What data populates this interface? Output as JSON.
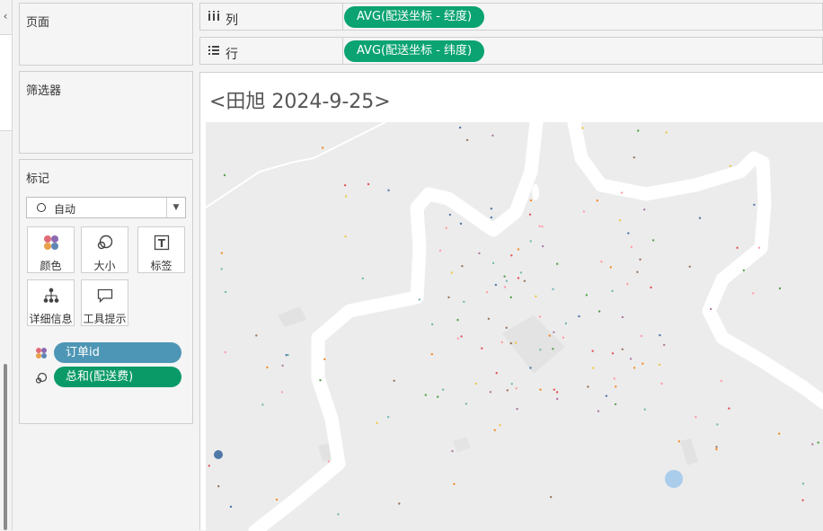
{
  "left_panel": {
    "collapse_icon": "chevron-left-icon"
  },
  "pages_card": {
    "title": "页面"
  },
  "filters_card": {
    "title": "筛选器"
  },
  "columns_shelf": {
    "label": "列",
    "icon": "columns-icon",
    "pill": "AVG(配送坐标 - 经度)"
  },
  "rows_shelf": {
    "label": "行",
    "icon": "rows-icon",
    "pill": "AVG(配送坐标 - 纬度)"
  },
  "marks_card": {
    "title": "标记",
    "mark_type": "自动",
    "buttons": [
      {
        "label": "颜色",
        "icon": "color-dots-icon"
      },
      {
        "label": "大小",
        "icon": "size-circles-icon"
      },
      {
        "label": "标签",
        "icon": "label-t-icon"
      },
      {
        "label": "详细信息",
        "icon": "detail-tree-icon"
      },
      {
        "label": "工具提示",
        "icon": "tooltip-bubble-icon"
      }
    ],
    "fields": [
      {
        "label": "订单id",
        "icon": "color-dots-icon",
        "color": "#4e96b5"
      },
      {
        "label": "总和(配送费)",
        "icon": "size-circles-icon",
        "color": "#0a9a68"
      }
    ]
  },
  "view": {
    "title": "<田旭 2024-9-25>",
    "map": {
      "background": "#ececec",
      "river_color": "#ffffff",
      "marks_note_colors": [
        "#e15759",
        "#4e79a7",
        "#f28e2b",
        "#76b7b2",
        "#59a14f",
        "#edc948",
        "#b07aa1",
        "#ff9da7",
        "#9c755f"
      ],
      "large_marks": [
        {
          "color": "#4e79a7"
        },
        {
          "color": "#a9cdeb"
        }
      ]
    }
  }
}
